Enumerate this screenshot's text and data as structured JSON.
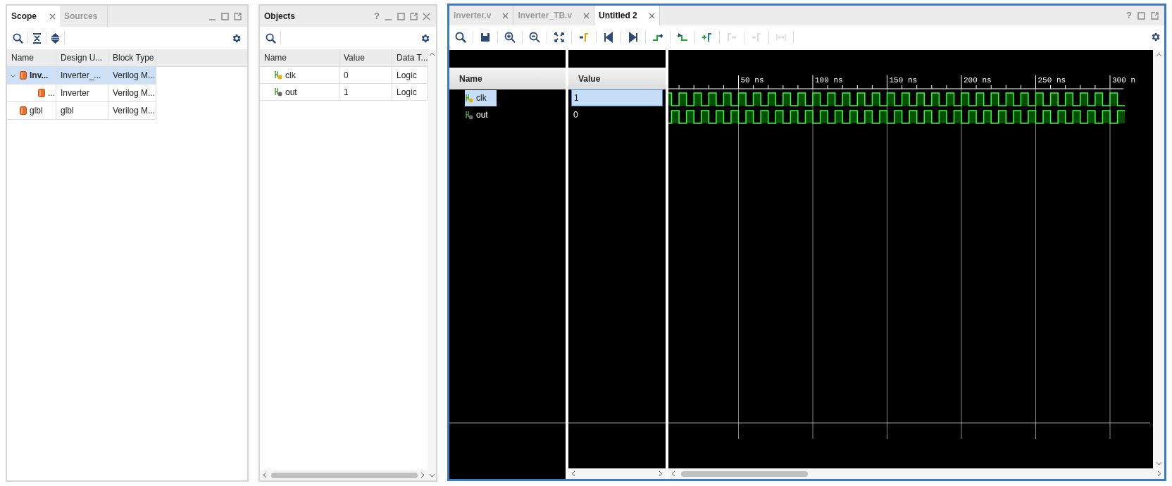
{
  "scope_panel": {
    "tabs": [
      {
        "label": "Scope",
        "selected": true
      },
      {
        "label": "Sources",
        "selected": false
      }
    ],
    "columns": [
      "Name",
      "Design U...",
      "Block Type"
    ],
    "rows": [
      {
        "name": "Inv...",
        "design_unit": "Inverter_...",
        "block_type": "Verilog M...",
        "selected": true,
        "expanded": true,
        "children": [
          {
            "name": "...",
            "design_unit": "Inverter",
            "block_type": "Verilog M...",
            "selected": false
          }
        ]
      },
      {
        "name": "glbl",
        "design_unit": "glbl",
        "block_type": "Verilog M...",
        "selected": false
      }
    ]
  },
  "objects_panel": {
    "title": "Objects",
    "help": "?",
    "columns": [
      "Name",
      "Value",
      "Data T..."
    ],
    "rows": [
      {
        "name": "clk",
        "value": "0",
        "data_type": "Logic",
        "kind": "clock"
      },
      {
        "name": "out",
        "value": "1",
        "data_type": "Logic",
        "kind": "output"
      }
    ]
  },
  "wave_window": {
    "tabs": [
      {
        "label": "inverter.v",
        "selected": false
      },
      {
        "label": "Inverter_TB.v",
        "selected": false
      },
      {
        "label": "Untitled 2",
        "selected": true
      }
    ],
    "help": "?",
    "toolbar": [
      {
        "disabled": false
      },
      {
        "disabled": false
      },
      {
        "disabled": false
      },
      {
        "disabled": false
      },
      {
        "disabled": false
      },
      {
        "disabled": false
      },
      {
        "disabled": false
      },
      {
        "disabled": false
      },
      {
        "disabled": false
      },
      {
        "disabled": false
      },
      {
        "disabled": false
      },
      {
        "disabled": true
      },
      {
        "disabled": true
      },
      {
        "disabled": true
      }
    ],
    "name_header": "Name",
    "value_header": "Value",
    "signals": [
      {
        "name": "clk",
        "value": "1",
        "selected": true,
        "kind": "clock"
      },
      {
        "name": "out",
        "value": "0",
        "selected": false,
        "kind": "output"
      }
    ],
    "ruler": [
      "50 ns",
      "100 ns",
      "150 ns",
      "200 ns",
      "250 ns",
      "300 n"
    ]
  }
}
